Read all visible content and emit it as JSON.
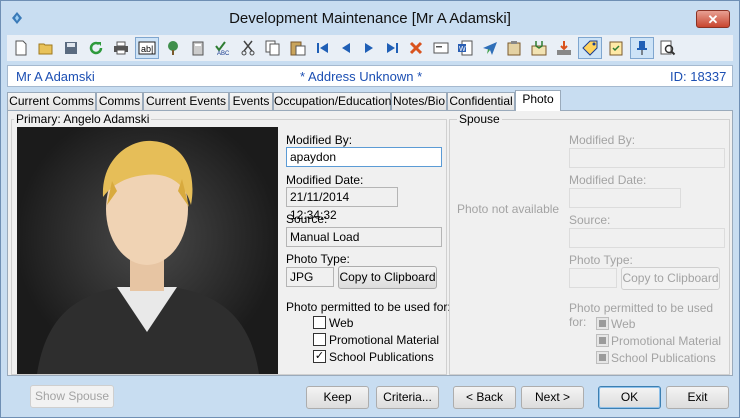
{
  "window": {
    "title": "Development Maintenance  [Mr A Adamski]",
    "close_glyph": "✕"
  },
  "toolbar": {
    "icons": [
      "new-icon",
      "open-icon",
      "save-icon",
      "refresh-icon",
      "print-icon",
      "text-field-icon",
      "tree-icon",
      "calculator-icon",
      "spellcheck-icon",
      "cut-icon",
      "copy-icon",
      "paste-icon",
      "first-record-icon",
      "previous-record-icon",
      "next-record-icon",
      "last-record-icon",
      "delete-icon",
      "card-icon",
      "word-doc-icon",
      "send-icon",
      "clipboard-icon",
      "mail-icon",
      "download-icon",
      "tag-icon",
      "checklist-icon",
      "pin-icon",
      "find-icon"
    ]
  },
  "infobar": {
    "name": "Mr A Adamski",
    "address": "* Address Unknown *",
    "id": "ID: 18337"
  },
  "tabs": [
    "Current Comms",
    "Comms",
    "Current Events",
    "Events",
    "Occupation/Education",
    "Notes/Bio",
    "Confidential",
    "Photo"
  ],
  "primary": {
    "group_label": "Primary: Angelo Adamski",
    "modified_by_label": "Modified By:",
    "modified_by": "apaydon",
    "modified_date_label": "Modified Date:",
    "modified_date": "21/11/2014 12:34:32",
    "source_label": "Source:",
    "source": "Manual Load",
    "photo_type_label": "Photo Type:",
    "photo_type": "JPG",
    "copy_button": "Copy to Clipboard",
    "permitted_label": "Photo permitted to be used for:",
    "permissions": [
      {
        "label": "Web",
        "checked": false
      },
      {
        "label": "Promotional Material",
        "checked": false
      },
      {
        "label": "School Publications",
        "checked": true
      }
    ]
  },
  "spouse": {
    "group_label": "Spouse",
    "no_photo": "Photo not available",
    "modified_by_label": "Modified By:",
    "modified_date_label": "Modified Date:",
    "source_label": "Source:",
    "photo_type_label": "Photo Type:",
    "copy_button": "Copy to Clipboard",
    "permitted_label": "Photo permitted to be used for:",
    "permissions": [
      "Web",
      "Promotional Material",
      "School Publications"
    ]
  },
  "footer": {
    "show_spouse": "Show Spouse",
    "keep": "Keep",
    "criteria": "Criteria...",
    "back": "< Back",
    "next": "Next >",
    "ok": "OK",
    "exit": "Exit"
  },
  "colors": {
    "window_bg": "#c8ddf1",
    "info_text": "#1c4fb3",
    "close_red": "#c8452f"
  }
}
